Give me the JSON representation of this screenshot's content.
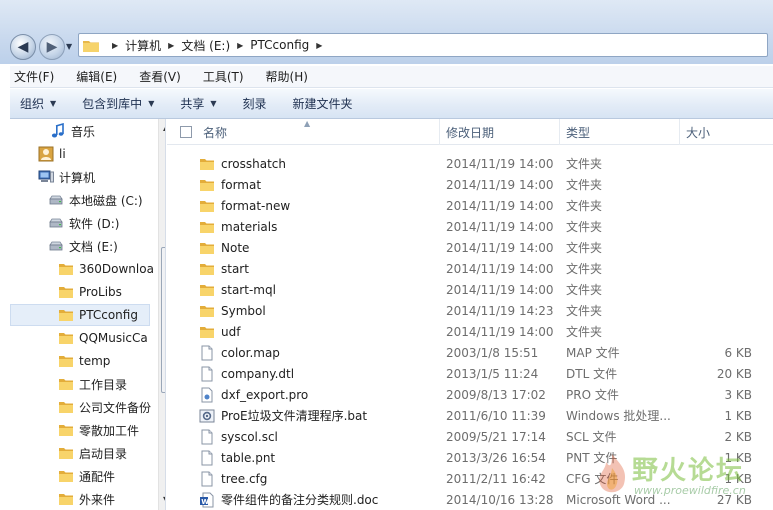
{
  "address": {
    "crumbs": [
      "计算机",
      "文档 (E:)",
      "PTCconfig"
    ]
  },
  "menu": [
    "文件(F)",
    "编辑(E)",
    "查看(V)",
    "工具(T)",
    "帮助(H)"
  ],
  "toolbar": {
    "organize": "组织",
    "include_library": "包含到库中",
    "share": "共享",
    "burn": "刻录",
    "new_folder": "新建文件夹"
  },
  "nav": {
    "items": [
      {
        "label": "音乐",
        "icon": "music-icon"
      },
      {
        "label": "li",
        "icon": "user-icon"
      },
      {
        "label": "计算机",
        "icon": "computer-icon"
      },
      {
        "label": "本地磁盘 (C:)",
        "icon": "drive-icon"
      },
      {
        "label": "软件 (D:)",
        "icon": "drive-icon"
      },
      {
        "label": "文档 (E:)",
        "icon": "drive-icon"
      },
      {
        "label": "360Downloa",
        "icon": "folder-icon"
      },
      {
        "label": "ProLibs",
        "icon": "folder-icon"
      },
      {
        "label": "PTCconfig",
        "icon": "folder-icon",
        "selected": true
      },
      {
        "label": "QQMusicCa",
        "icon": "folder-icon"
      },
      {
        "label": "temp",
        "icon": "folder-icon"
      },
      {
        "label": "工作目录",
        "icon": "folder-icon"
      },
      {
        "label": "公司文件备份",
        "icon": "folder-icon"
      },
      {
        "label": "零散加工件",
        "icon": "folder-icon"
      },
      {
        "label": "启动目录",
        "icon": "folder-icon"
      },
      {
        "label": "通配件",
        "icon": "folder-icon"
      },
      {
        "label": "外来件",
        "icon": "folder-icon"
      }
    ]
  },
  "columns": {
    "name": "名称",
    "date": "修改日期",
    "type": "类型",
    "size": "大小"
  },
  "files": [
    {
      "name": "crosshatch",
      "date": "2014/11/19 14:00",
      "type": "文件夹",
      "size": "",
      "icon": "folder-icon"
    },
    {
      "name": "format",
      "date": "2014/11/19 14:00",
      "type": "文件夹",
      "size": "",
      "icon": "folder-icon"
    },
    {
      "name": "format-new",
      "date": "2014/11/19 14:00",
      "type": "文件夹",
      "size": "",
      "icon": "folder-icon"
    },
    {
      "name": "materials",
      "date": "2014/11/19 14:00",
      "type": "文件夹",
      "size": "",
      "icon": "folder-icon"
    },
    {
      "name": "Note",
      "date": "2014/11/19 14:00",
      "type": "文件夹",
      "size": "",
      "icon": "folder-icon"
    },
    {
      "name": "start",
      "date": "2014/11/19 14:00",
      "type": "文件夹",
      "size": "",
      "icon": "folder-icon"
    },
    {
      "name": "start-mql",
      "date": "2014/11/19 14:00",
      "type": "文件夹",
      "size": "",
      "icon": "folder-icon"
    },
    {
      "name": "Symbol",
      "date": "2014/11/19 14:23",
      "type": "文件夹",
      "size": "",
      "icon": "folder-icon"
    },
    {
      "name": "udf",
      "date": "2014/11/19 14:00",
      "type": "文件夹",
      "size": "",
      "icon": "folder-icon"
    },
    {
      "name": "color.map",
      "date": "2003/1/8 15:51",
      "type": "MAP 文件",
      "size": "6 KB",
      "icon": "file-icon"
    },
    {
      "name": "company.dtl",
      "date": "2013/1/5 11:24",
      "type": "DTL 文件",
      "size": "20 KB",
      "icon": "file-icon"
    },
    {
      "name": "dxf_export.pro",
      "date": "2009/8/13 17:02",
      "type": "PRO 文件",
      "size": "3 KB",
      "icon": "config-file-icon"
    },
    {
      "name": "ProE垃圾文件清理程序.bat",
      "date": "2011/6/10 11:39",
      "type": "Windows 批处理...",
      "size": "1 KB",
      "icon": "batch-file-icon"
    },
    {
      "name": "syscol.scl",
      "date": "2009/5/21 17:14",
      "type": "SCL 文件",
      "size": "2 KB",
      "icon": "file-icon"
    },
    {
      "name": "table.pnt",
      "date": "2013/3/26 16:54",
      "type": "PNT 文件",
      "size": "1 KB",
      "icon": "file-icon"
    },
    {
      "name": "tree.cfg",
      "date": "2011/2/11 16:42",
      "type": "CFG 文件",
      "size": "1 KB",
      "icon": "file-icon"
    },
    {
      "name": "零件组件的备注分类规则.doc",
      "date": "2014/10/16 13:28",
      "type": "Microsoft Word ...",
      "size": "27 KB",
      "icon": "word-doc-icon"
    }
  ],
  "watermark": {
    "text": "野火论坛",
    "url": "www.proewildfire.cn"
  }
}
